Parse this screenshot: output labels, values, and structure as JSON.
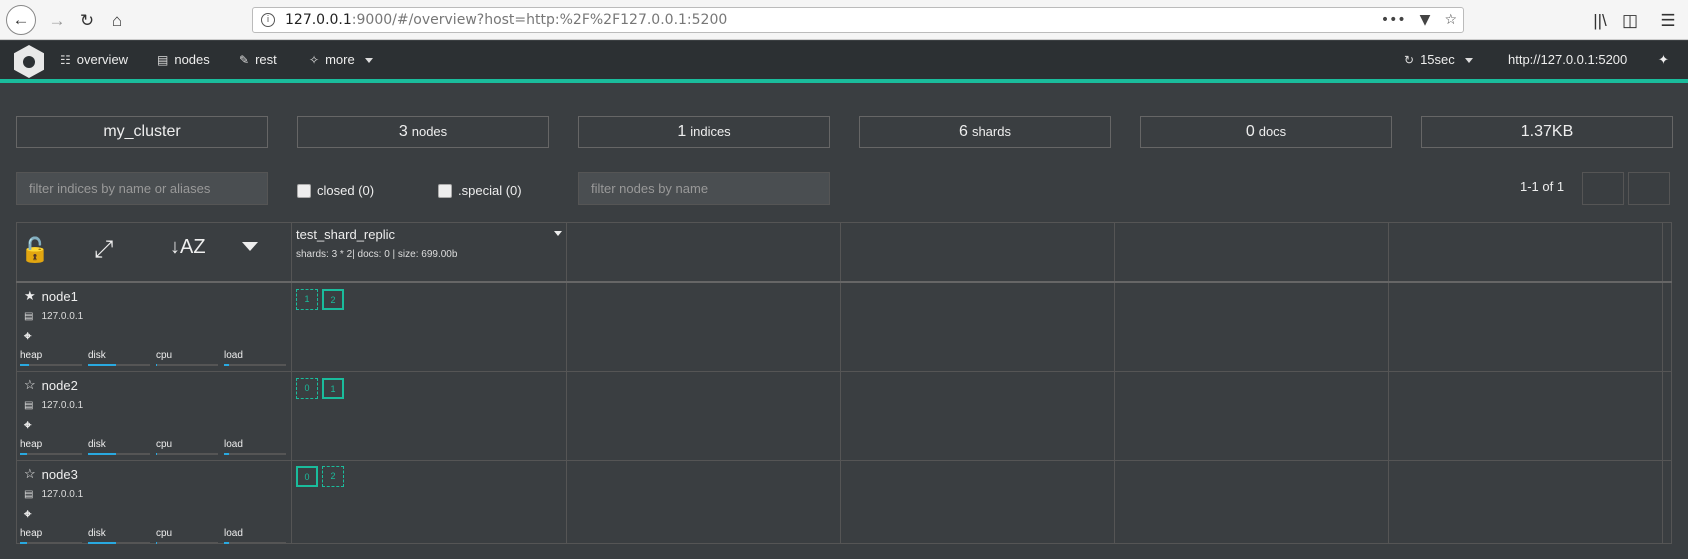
{
  "browser": {
    "url_host": "127.0.0.1",
    "url_rest": ":9000/#/overview?host=http:%2F%2F127.0.0.1:5200",
    "menu_dots": "•••"
  },
  "nav": {
    "items": [
      {
        "label": "overview",
        "icon": "sitemap-icon"
      },
      {
        "label": "nodes",
        "icon": "server-icon"
      },
      {
        "label": "rest",
        "icon": "edit-icon"
      },
      {
        "label": "more",
        "icon": "magic-wand-icon"
      }
    ],
    "refresh_label": "15sec",
    "host_label": "http://127.0.0.1:5200",
    "accent_color": "#1abc9c"
  },
  "stats": {
    "cluster_name": "my_cluster",
    "nodes_count": "3",
    "nodes_unit": "nodes",
    "indices_count": "1",
    "indices_unit": "indices",
    "shards_count": "6",
    "shards_unit": "shards",
    "docs_count": "0",
    "docs_unit": "docs",
    "size": "1.37KB"
  },
  "filters": {
    "indices_placeholder": "filter indices by name or aliases",
    "closed_label": "closed (0)",
    "special_label": ".special (0)",
    "nodes_placeholder": "filter nodes by name",
    "pager_text": "1-1 of 1"
  },
  "index": {
    "name": "test_shard_replic",
    "meta": "shards: 3 * 2| docs: 0 | size: 699.00b"
  },
  "metric_labels": {
    "heap": "heap",
    "disk": "disk",
    "cpu": "cpu",
    "load": "load"
  },
  "nodes": [
    {
      "name": "node1",
      "ip": "127.0.0.1",
      "master": true,
      "heap": 0.15,
      "disk": 0.45,
      "cpu": 0.02,
      "load": 0.08,
      "shards": [
        {
          "n": "1",
          "primary": false
        },
        {
          "n": "2",
          "primary": true
        }
      ]
    },
    {
      "name": "node2",
      "ip": "127.0.0.1",
      "master": false,
      "heap": 0.12,
      "disk": 0.45,
      "cpu": 0.02,
      "load": 0.08,
      "shards": [
        {
          "n": "0",
          "primary": false
        },
        {
          "n": "1",
          "primary": true
        }
      ]
    },
    {
      "name": "node3",
      "ip": "127.0.0.1",
      "master": false,
      "heap": 0.12,
      "disk": 0.45,
      "cpu": 0.02,
      "load": 0.08,
      "shards": [
        {
          "n": "0",
          "primary": true
        },
        {
          "n": "2",
          "primary": false
        }
      ]
    }
  ]
}
